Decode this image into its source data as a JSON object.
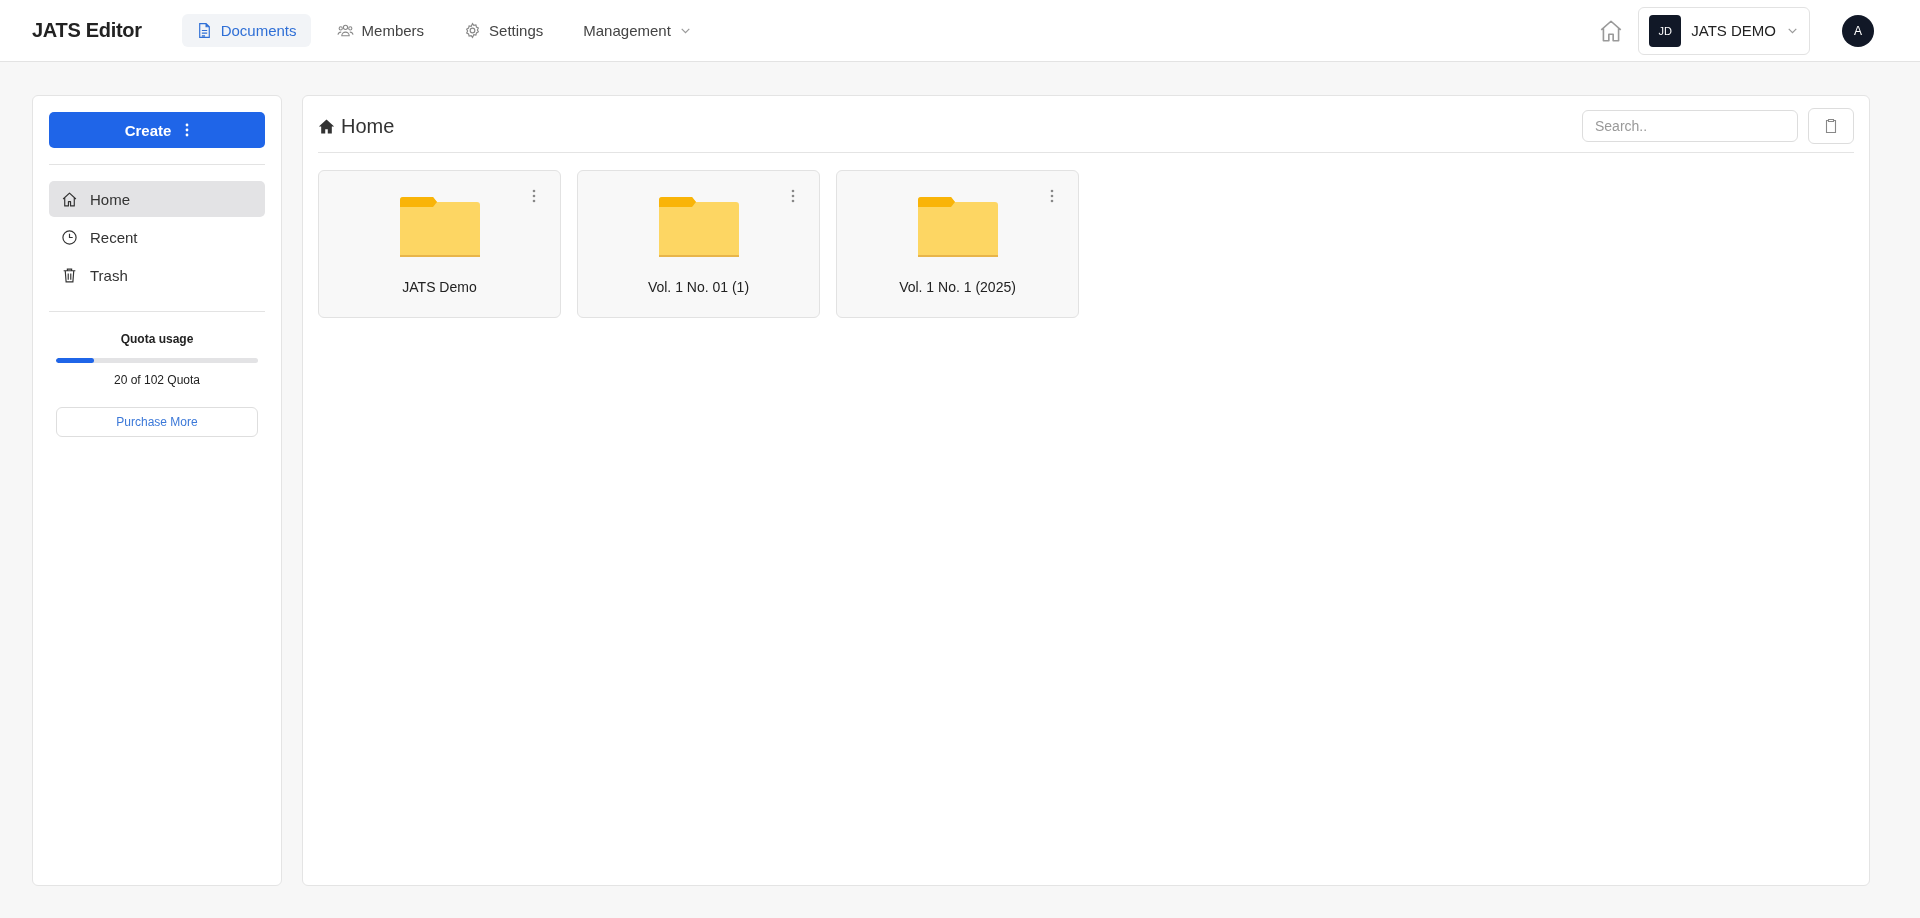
{
  "app_title": "JATS Editor",
  "nav": [
    {
      "label": "Documents",
      "kind": "document",
      "selected": true
    },
    {
      "label": "Members",
      "kind": "people",
      "selected": false
    },
    {
      "label": "Settings",
      "kind": "gear",
      "selected": false
    },
    {
      "label": "Management",
      "kind": "menu",
      "selected": false
    }
  ],
  "workspace": {
    "initials": "JD",
    "name": "JATS DEMO"
  },
  "user_avatar": "A",
  "sidebar": {
    "create_button": "Create",
    "items": [
      {
        "label": "Home",
        "kind": "home",
        "selected": true
      },
      {
        "label": "Recent",
        "kind": "clock",
        "selected": false
      },
      {
        "label": "Trash",
        "kind": "trash",
        "selected": false
      }
    ],
    "quota": {
      "title": "Quota usage",
      "level": 0.19,
      "reading": "20 of 102 Quota",
      "button": "Purchase More"
    }
  },
  "main": {
    "title": "Home",
    "search": {
      "placeholder": "Search.."
    },
    "folders": [
      {
        "name": "JATS Demo"
      },
      {
        "name": "Vol. 1 No. 01 (1)"
      },
      {
        "name": "Vol. 1 No. 1 (2025)"
      }
    ]
  }
}
